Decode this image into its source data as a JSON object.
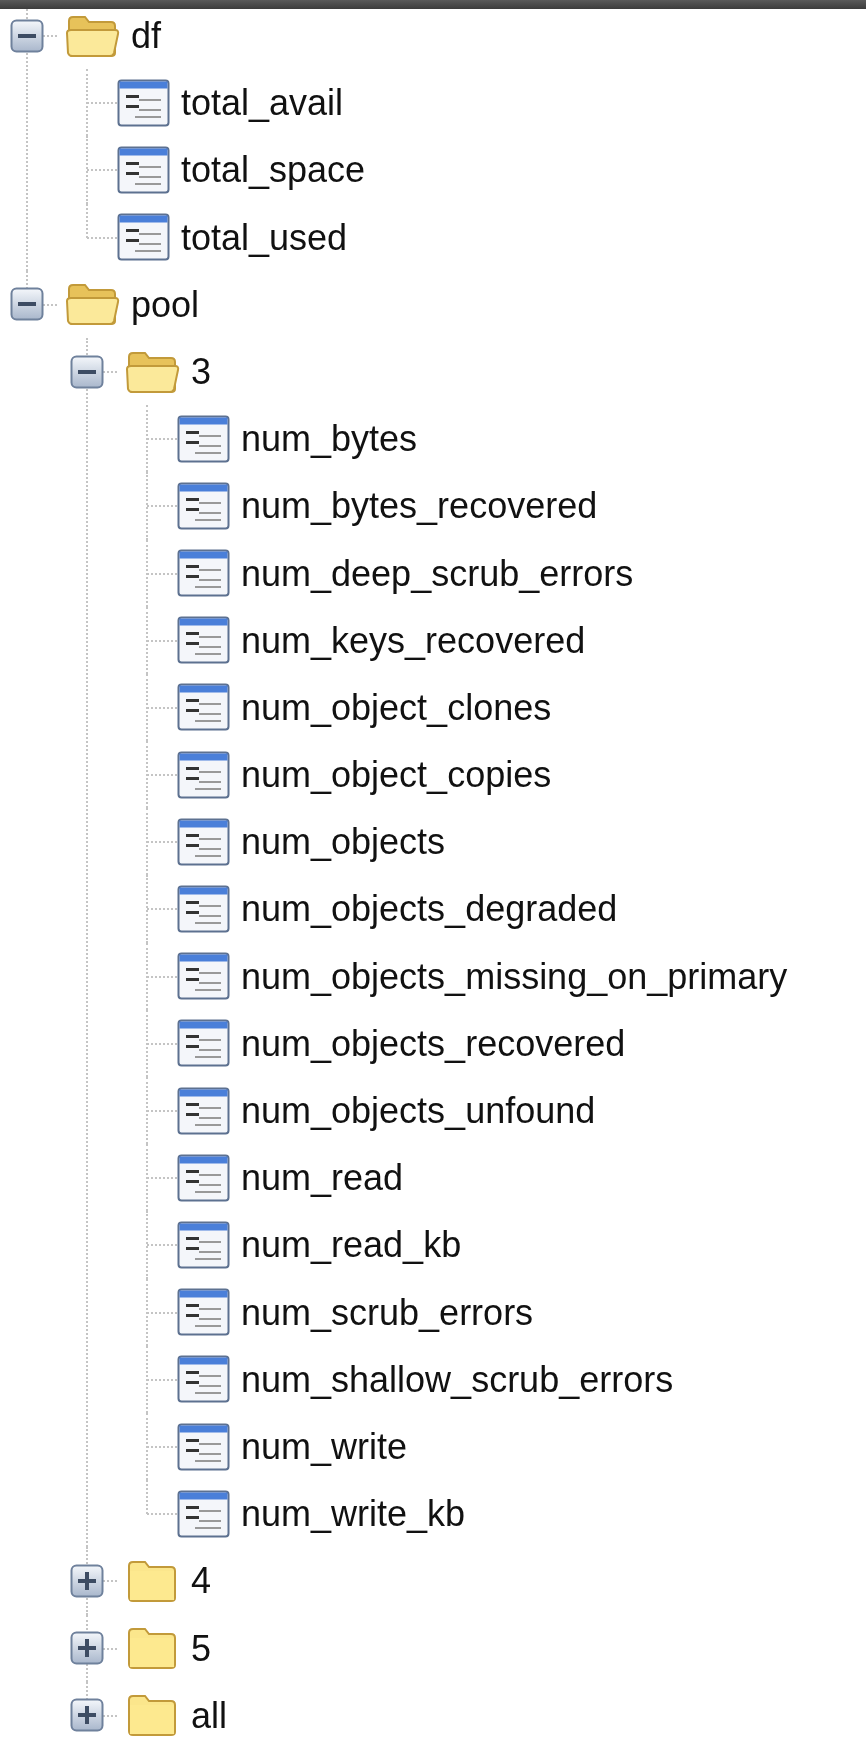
{
  "tree": [
    {
      "label": "df",
      "kind": "folder",
      "expanded": true,
      "children": [
        {
          "label": "total_avail",
          "kind": "file"
        },
        {
          "label": "total_space",
          "kind": "file"
        },
        {
          "label": "total_used",
          "kind": "file"
        }
      ]
    },
    {
      "label": "pool",
      "kind": "folder",
      "expanded": true,
      "children": [
        {
          "label": "3",
          "kind": "folder",
          "expanded": true,
          "children": [
            {
              "label": "num_bytes",
              "kind": "file"
            },
            {
              "label": "num_bytes_recovered",
              "kind": "file"
            },
            {
              "label": "num_deep_scrub_errors",
              "kind": "file"
            },
            {
              "label": "num_keys_recovered",
              "kind": "file"
            },
            {
              "label": "num_object_clones",
              "kind": "file"
            },
            {
              "label": "num_object_copies",
              "kind": "file"
            },
            {
              "label": "num_objects",
              "kind": "file"
            },
            {
              "label": "num_objects_degraded",
              "kind": "file"
            },
            {
              "label": "num_objects_missing_on_primary",
              "kind": "file"
            },
            {
              "label": "num_objects_recovered",
              "kind": "file"
            },
            {
              "label": "num_objects_unfound",
              "kind": "file"
            },
            {
              "label": "num_read",
              "kind": "file"
            },
            {
              "label": "num_read_kb",
              "kind": "file"
            },
            {
              "label": "num_scrub_errors",
              "kind": "file"
            },
            {
              "label": "num_shallow_scrub_errors",
              "kind": "file"
            },
            {
              "label": "num_write",
              "kind": "file"
            },
            {
              "label": "num_write_kb",
              "kind": "file"
            }
          ]
        },
        {
          "label": "4",
          "kind": "folder",
          "expanded": false
        },
        {
          "label": "5",
          "kind": "folder",
          "expanded": false
        },
        {
          "label": "all",
          "kind": "folder",
          "expanded": false
        }
      ]
    }
  ]
}
